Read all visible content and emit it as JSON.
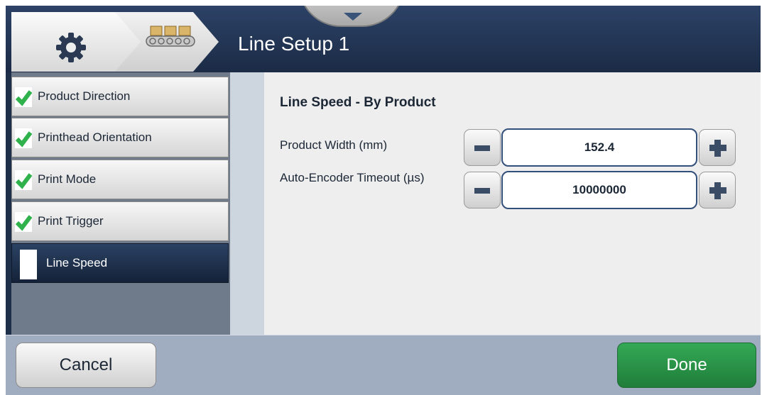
{
  "header": {
    "title": "Line Setup 1",
    "breadcrumb": [
      {
        "icon": "gear-icon"
      },
      {
        "icon": "conveyor-icon"
      }
    ],
    "pulldown_icon": "chevron-down-icon"
  },
  "sidebar": {
    "items": [
      {
        "label": "Product Direction",
        "status": "complete"
      },
      {
        "label": "Printhead Orientation",
        "status": "complete"
      },
      {
        "label": "Print Mode",
        "status": "complete"
      },
      {
        "label": "Print Trigger",
        "status": "complete"
      },
      {
        "label": "Line Speed",
        "status": "active"
      }
    ]
  },
  "main": {
    "section_title": "Line Speed - By Product",
    "fields": [
      {
        "label": "Product Width (mm)",
        "value": "152.4"
      },
      {
        "label": "Auto-Encoder Timeout (µs)",
        "value": "10000000"
      }
    ]
  },
  "footer": {
    "cancel_label": "Cancel",
    "done_label": "Done"
  },
  "colors": {
    "header_bg": "#1e2f4a",
    "check_green": "#2fb24b",
    "done_green": "#259043",
    "field_border": "#33507a"
  }
}
